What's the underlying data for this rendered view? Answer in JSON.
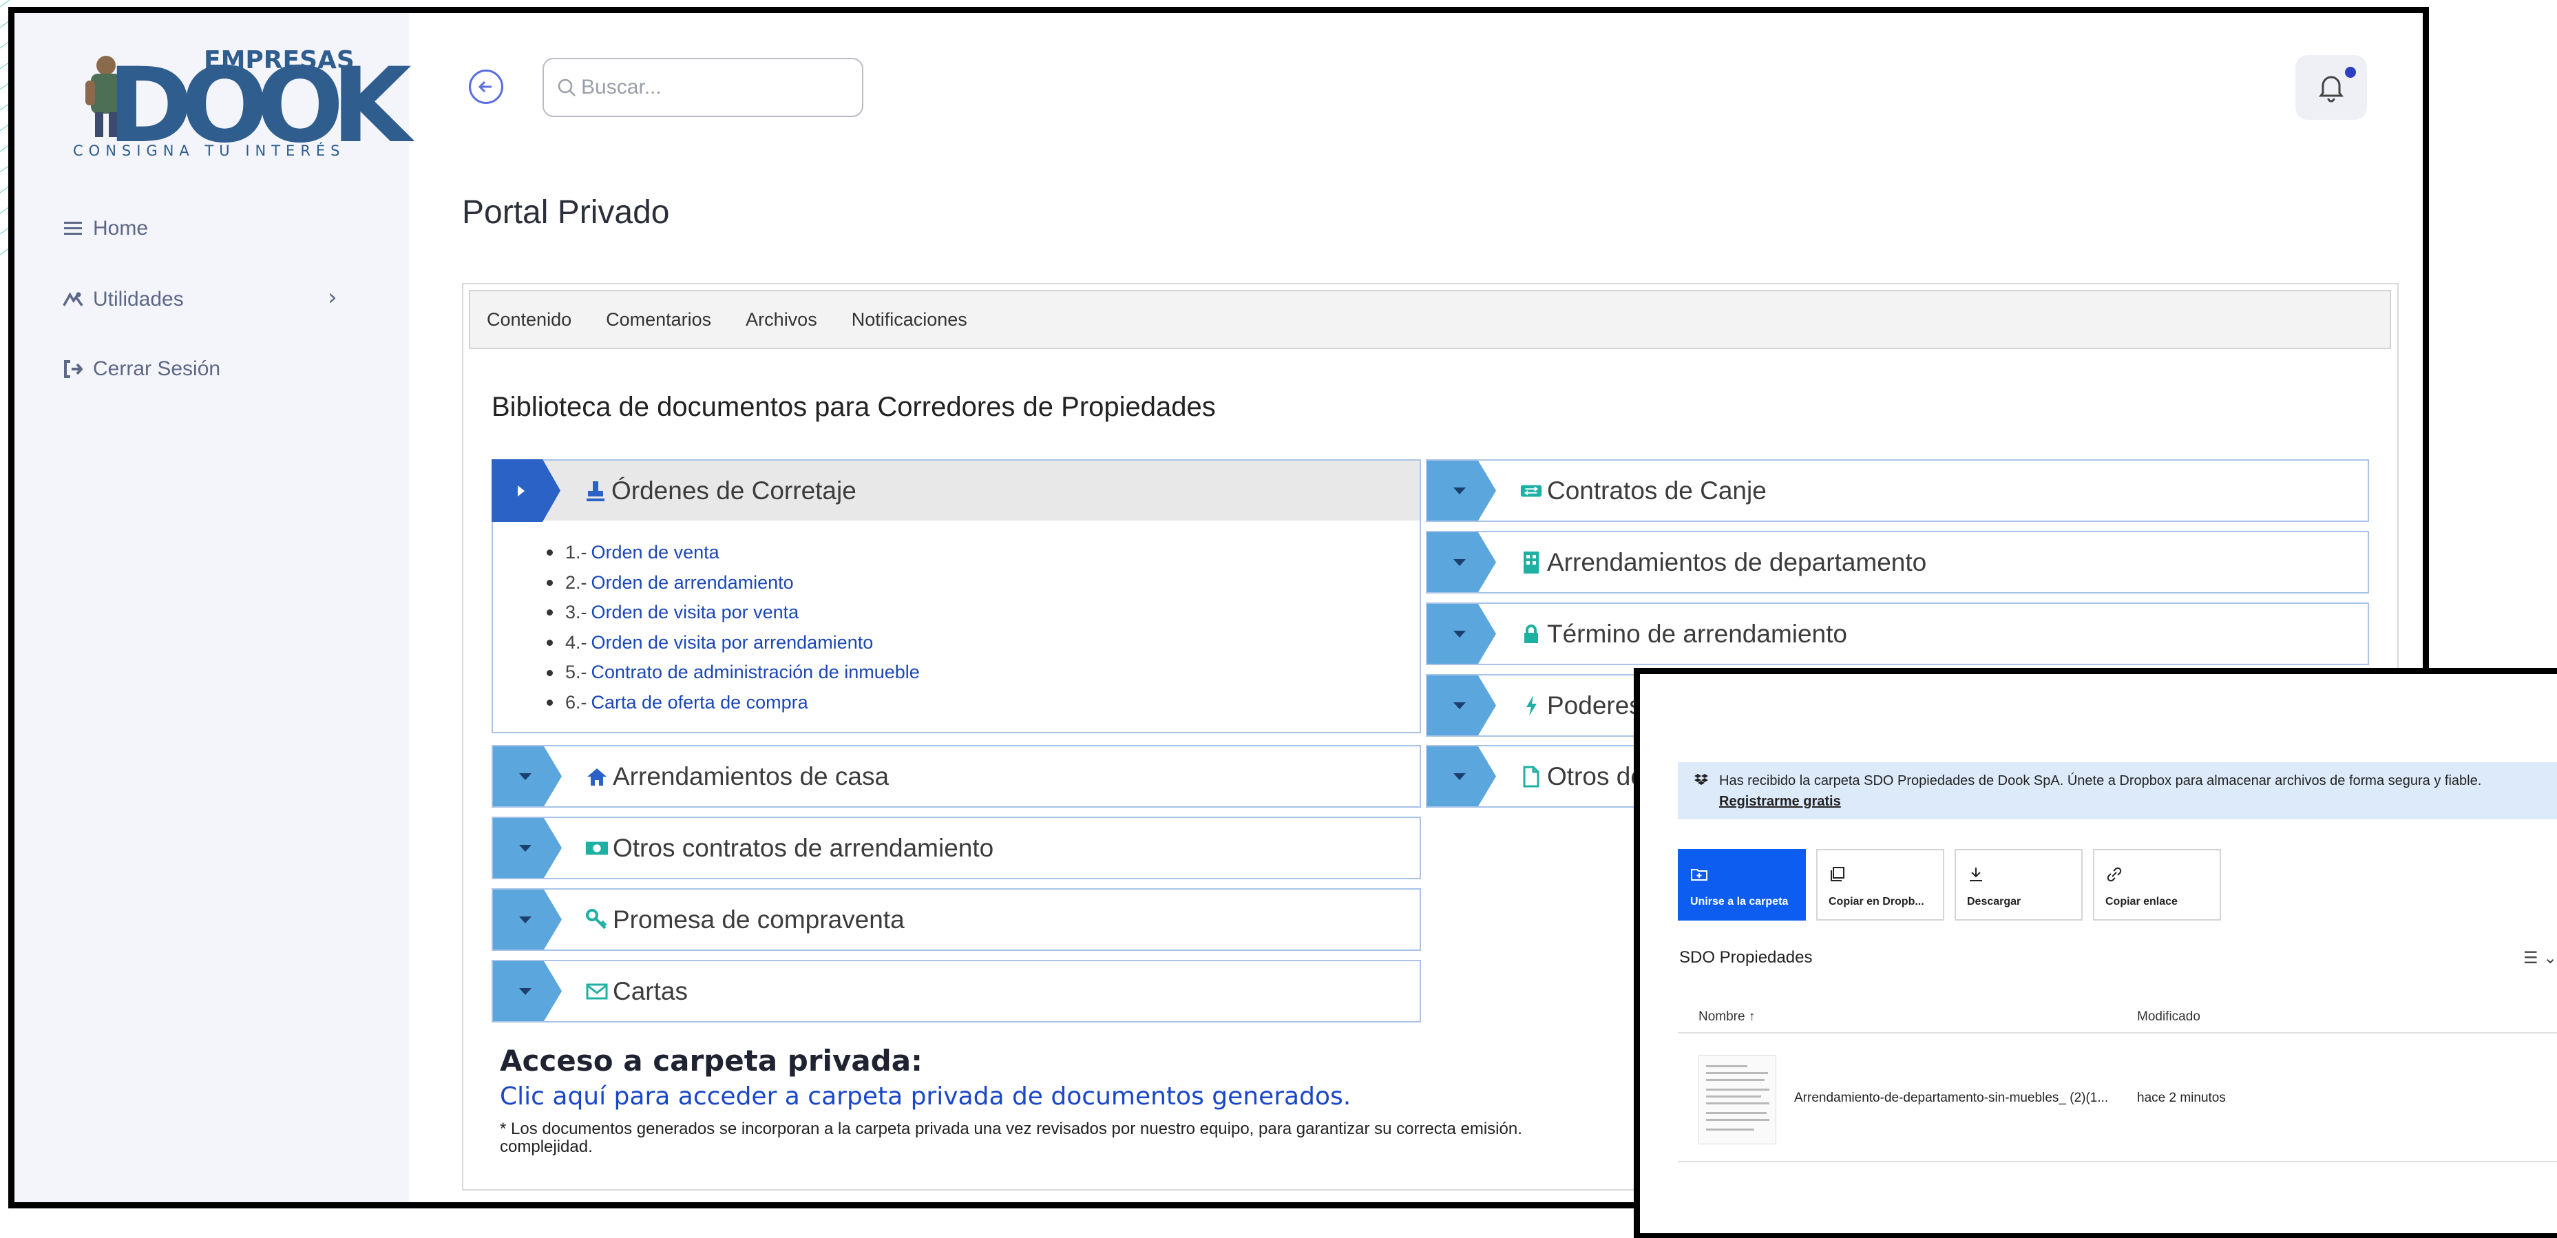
{
  "logo": {
    "top": "EMPRESAS",
    "brand": "DOOK",
    "tagline": "CONSIGNA TU INTERÉS"
  },
  "sidebar": {
    "items": [
      {
        "label": "Home",
        "icon": "menu-icon"
      },
      {
        "label": "Utilidades",
        "icon": "tools-icon"
      },
      {
        "label": "Cerrar Sesión",
        "icon": "sign-out-icon"
      }
    ]
  },
  "header": {
    "search_placeholder": "Buscar..."
  },
  "page": {
    "title": "Portal Privado"
  },
  "tabs": [
    "Contenido",
    "Comentarios",
    "Archivos",
    "Notificaciones"
  ],
  "library": {
    "title": "Biblioteca de documentos para Corredores de Propiedades",
    "left": [
      {
        "label": "Órdenes de Corretaje",
        "icon": "stamp-icon",
        "open": true
      },
      {
        "label": "Arrendamientos de casa",
        "icon": "home-icon"
      },
      {
        "label": "Otros contratos de arrendamiento",
        "icon": "money-icon"
      },
      {
        "label": "Promesa de compraventa",
        "icon": "key-icon"
      },
      {
        "label": "Cartas",
        "icon": "envelope-icon"
      }
    ],
    "right": [
      {
        "label": "Contratos de Canje",
        "icon": "exchange-icon"
      },
      {
        "label": "Arrendamientos de departamento",
        "icon": "building-icon"
      },
      {
        "label": "Término de arrendamiento",
        "icon": "lock-icon"
      },
      {
        "label": "Poderes",
        "icon": "bolt-icon"
      },
      {
        "label": "Otros do",
        "icon": "file-icon"
      }
    ],
    "open_list": [
      {
        "num": "1.-",
        "text": "Orden de venta"
      },
      {
        "num": "2.-",
        "text": "Orden de arrendamiento"
      },
      {
        "num": "3.-",
        "text": "Orden de visita por venta"
      },
      {
        "num": "4.-",
        "text": "Orden de visita por arrendamiento"
      },
      {
        "num": "5.-",
        "text": "Contrato de administración de inmueble"
      },
      {
        "num": "6.-",
        "text": "Carta de oferta de compra"
      }
    ]
  },
  "access": {
    "title": "Acceso a carpeta privada:",
    "link": "Clic aquí para acceder a carpeta privada de documentos generados.",
    "note_line1": "* Los documentos generados se incorporan a la carpeta privada una vez revisados por nuestro equipo, para garantizar su correcta emisión.",
    "note_line2": "complejidad."
  },
  "dropbox": {
    "banner_msg": "Has recibido la carpeta SDO Propiedades de Dook SpA. Únete a Dropbox para almacenar archivos de forma segura y fiable.",
    "banner_cta": "Registrarme gratis",
    "buttons": [
      {
        "label": "Unirse a la carpeta",
        "icon": "folder-plus-icon"
      },
      {
        "label": "Copiar en Dropb...",
        "icon": "copy-icon"
      },
      {
        "label": "Descargar",
        "icon": "download-icon"
      },
      {
        "label": "Copiar enlace",
        "icon": "link-icon"
      }
    ],
    "folder": "SDO Propiedades",
    "view_toggle": "☰ ⌄",
    "columns": {
      "name": "Nombre ↑",
      "modified": "Modificado"
    },
    "files": [
      {
        "name": "Arrendamiento-de-departamento-sin-muebles_ (2)(1...",
        "modified": "hace 2 minutos"
      }
    ]
  },
  "colors": {
    "accent": "#2a63c5",
    "arrow": "#5aa6dd",
    "link": "#1a47b8",
    "dropbox_blue": "#0d5ef0",
    "sidebar_bg": "#f4f5fa"
  }
}
